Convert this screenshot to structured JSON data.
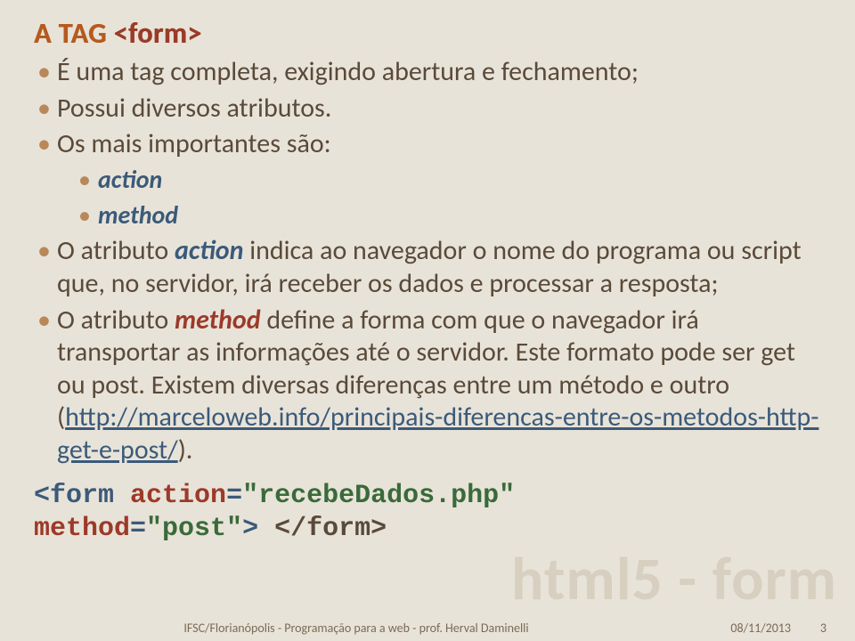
{
  "title": {
    "a": "A",
    "tag": "TAG",
    "form": "<form>"
  },
  "bullets": {
    "b1": "É uma tag completa, exigindo abertura e fechamento;",
    "b2": "Possui diversos atributos.",
    "b3": "Os mais importantes são:",
    "sub1": "action",
    "sub2": "method",
    "b4a": "O atributo ",
    "b4_action": "action",
    "b4b": " indica ao navegador o nome do programa ou script que, no servidor, irá receber os dados e processar a resposta;",
    "b5a": "O atributo ",
    "b5_method": "method",
    "b5b": " define a forma com que o navegador irá transportar as informações até o servidor. Este formato pode ser get ou post. Existem diversas diferenças entre um método e outro (",
    "b5_link": "http://marceloweb.info/principais-diferencas-entre-os-metodos-http-get-e-post/",
    "b5c": ")."
  },
  "code": {
    "open_lt": "<",
    "tag": "form",
    "sp": " ",
    "attr1": "action",
    "eq": "=",
    "val1": "\"recebeDados.php\"",
    "attr2": "method",
    "val2": "\"post\"",
    "gt": ">",
    "close": "</form>"
  },
  "watermark": "html5 - form",
  "footer": {
    "center": "IFSC/Florianópolis - Programação para a web - prof. Herval Daminelli",
    "date": "08/11/2013",
    "page": "3"
  }
}
